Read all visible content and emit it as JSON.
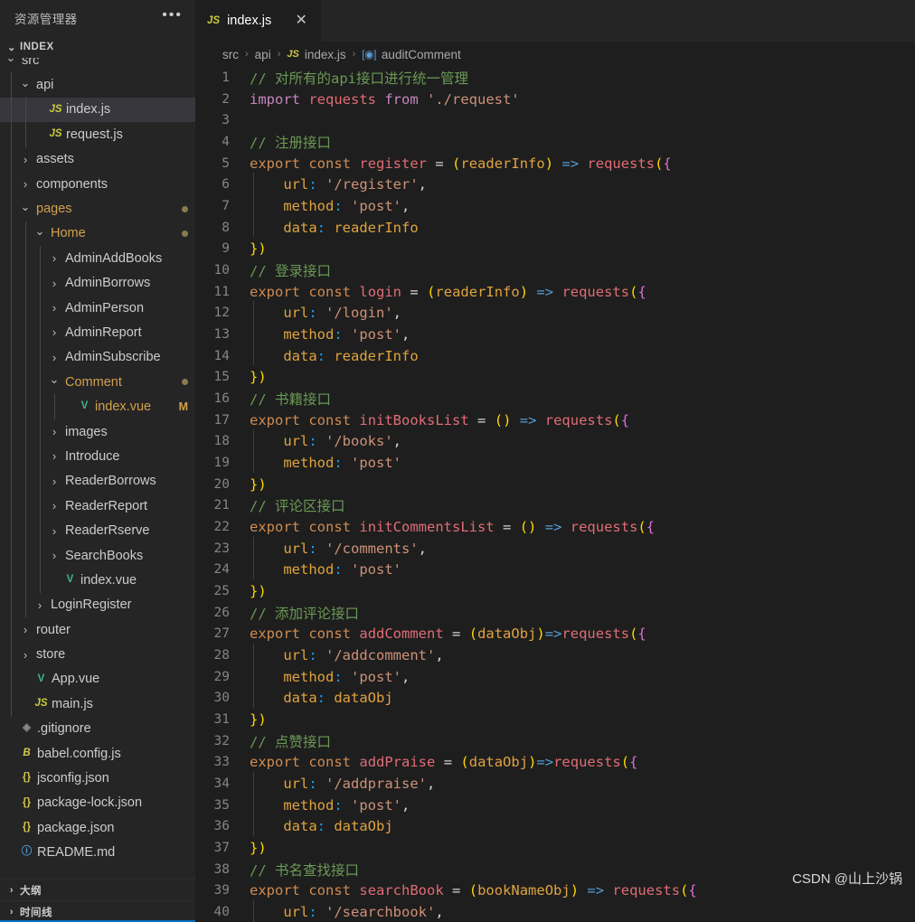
{
  "sidebar": {
    "title": "资源管理器",
    "more_label": "•••",
    "index_section": {
      "label": "INDEX",
      "chevron": "⌄"
    },
    "outline_section": {
      "label": "大纲",
      "chevron": "›"
    },
    "timeline_section": {
      "label": "时间线",
      "chevron": "›"
    },
    "tree": [
      {
        "label": "src",
        "kind": "folder",
        "indent": 0,
        "expanded": true,
        "clipped": true,
        "icon": "chevron-down-icon"
      },
      {
        "label": "api",
        "kind": "folder",
        "indent": 1,
        "expanded": true,
        "icon": "chevron-down-icon"
      },
      {
        "label": "index.js",
        "kind": "file",
        "indent": 2,
        "icon": "js-file-icon",
        "selected": true
      },
      {
        "label": "request.js",
        "kind": "file",
        "indent": 2,
        "icon": "js-file-icon"
      },
      {
        "label": "assets",
        "kind": "folder",
        "indent": 1,
        "expanded": false,
        "icon": "chevron-right-icon"
      },
      {
        "label": "components",
        "kind": "folder",
        "indent": 1,
        "expanded": false,
        "icon": "chevron-right-icon"
      },
      {
        "label": "pages",
        "kind": "folder",
        "indent": 1,
        "expanded": true,
        "icon": "chevron-down-icon",
        "dot": true
      },
      {
        "label": "Home",
        "kind": "folder",
        "indent": 2,
        "expanded": true,
        "icon": "chevron-down-icon",
        "dot": true
      },
      {
        "label": "AdminAddBooks",
        "kind": "folder",
        "indent": 3,
        "expanded": false,
        "icon": "chevron-right-icon"
      },
      {
        "label": "AdminBorrows",
        "kind": "folder",
        "indent": 3,
        "expanded": false,
        "icon": "chevron-right-icon"
      },
      {
        "label": "AdminPerson",
        "kind": "folder",
        "indent": 3,
        "expanded": false,
        "icon": "chevron-right-icon"
      },
      {
        "label": "AdminReport",
        "kind": "folder",
        "indent": 3,
        "expanded": false,
        "icon": "chevron-right-icon"
      },
      {
        "label": "AdminSubscribe",
        "kind": "folder",
        "indent": 3,
        "expanded": false,
        "icon": "chevron-right-icon"
      },
      {
        "label": "Comment",
        "kind": "folder",
        "indent": 3,
        "expanded": true,
        "icon": "chevron-down-icon",
        "dot": true
      },
      {
        "label": "index.vue",
        "kind": "file",
        "indent": 4,
        "icon": "vue-file-icon",
        "badge": "M"
      },
      {
        "label": "images",
        "kind": "folder",
        "indent": 3,
        "expanded": false,
        "icon": "chevron-right-icon"
      },
      {
        "label": "Introduce",
        "kind": "folder",
        "indent": 3,
        "expanded": false,
        "icon": "chevron-right-icon"
      },
      {
        "label": "ReaderBorrows",
        "kind": "folder",
        "indent": 3,
        "expanded": false,
        "icon": "chevron-right-icon"
      },
      {
        "label": "ReaderReport",
        "kind": "folder",
        "indent": 3,
        "expanded": false,
        "icon": "chevron-right-icon"
      },
      {
        "label": "ReaderRserve",
        "kind": "folder",
        "indent": 3,
        "expanded": false,
        "icon": "chevron-right-icon"
      },
      {
        "label": "SearchBooks",
        "kind": "folder",
        "indent": 3,
        "expanded": false,
        "icon": "chevron-right-icon"
      },
      {
        "label": "index.vue",
        "kind": "file",
        "indent": 3,
        "icon": "vue-file-icon"
      },
      {
        "label": "LoginRegister",
        "kind": "folder",
        "indent": 2,
        "expanded": false,
        "icon": "chevron-right-icon"
      },
      {
        "label": "router",
        "kind": "folder",
        "indent": 1,
        "expanded": false,
        "icon": "chevron-right-icon"
      },
      {
        "label": "store",
        "kind": "folder",
        "indent": 1,
        "expanded": false,
        "icon": "chevron-right-icon"
      },
      {
        "label": "App.vue",
        "kind": "file",
        "indent": 1,
        "icon": "vue-file-icon"
      },
      {
        "label": "main.js",
        "kind": "file",
        "indent": 1,
        "icon": "js-file-icon"
      },
      {
        "label": ".gitignore",
        "kind": "file",
        "indent": 0,
        "icon": "git-file-icon"
      },
      {
        "label": "babel.config.js",
        "kind": "file",
        "indent": 0,
        "icon": "babel-file-icon"
      },
      {
        "label": "jsconfig.json",
        "kind": "file",
        "indent": 0,
        "icon": "json-file-icon"
      },
      {
        "label": "package-lock.json",
        "kind": "file",
        "indent": 0,
        "icon": "json-file-icon"
      },
      {
        "label": "package.json",
        "kind": "file",
        "indent": 0,
        "icon": "json-file-icon"
      },
      {
        "label": "README.md",
        "kind": "file",
        "indent": 0,
        "icon": "markdown-file-icon"
      }
    ]
  },
  "editor": {
    "tab": {
      "label": "index.js",
      "icon": "js-file-icon",
      "close": "✕"
    },
    "breadcrumb": [
      {
        "label": "src",
        "icon": null
      },
      {
        "label": "api",
        "icon": null
      },
      {
        "label": "index.js",
        "icon": "js-file-icon"
      },
      {
        "label": "auditComment",
        "icon": "symbol-method-icon"
      }
    ],
    "breadcrumb_separator": "›",
    "first_line": 1,
    "last_line": 40,
    "lines": [
      {
        "n": 1,
        "text": "// 对所有的api接口进行统一管理"
      },
      {
        "n": 2,
        "text": "import requests from './request'"
      },
      {
        "n": 3,
        "text": ""
      },
      {
        "n": 4,
        "text": "// 注册接口"
      },
      {
        "n": 5,
        "text": "export const register = (readerInfo) => requests({"
      },
      {
        "n": 6,
        "text": "    url: '/register',"
      },
      {
        "n": 7,
        "text": "    method: 'post',"
      },
      {
        "n": 8,
        "text": "    data: readerInfo"
      },
      {
        "n": 9,
        "text": "})"
      },
      {
        "n": 10,
        "text": "// 登录接口"
      },
      {
        "n": 11,
        "text": "export const login = (readerInfo) => requests({"
      },
      {
        "n": 12,
        "text": "    url: '/login',"
      },
      {
        "n": 13,
        "text": "    method: 'post',"
      },
      {
        "n": 14,
        "text": "    data: readerInfo"
      },
      {
        "n": 15,
        "text": "})"
      },
      {
        "n": 16,
        "text": "// 书籍接口"
      },
      {
        "n": 17,
        "text": "export const initBooksList = () => requests({"
      },
      {
        "n": 18,
        "text": "    url: '/books',"
      },
      {
        "n": 19,
        "text": "    method: 'post'"
      },
      {
        "n": 20,
        "text": "})"
      },
      {
        "n": 21,
        "text": "// 评论区接口"
      },
      {
        "n": 22,
        "text": "export const initCommentsList = () => requests({"
      },
      {
        "n": 23,
        "text": "    url: '/comments',"
      },
      {
        "n": 24,
        "text": "    method: 'post'"
      },
      {
        "n": 25,
        "text": "})"
      },
      {
        "n": 26,
        "text": "// 添加评论接口"
      },
      {
        "n": 27,
        "text": "export const addComment = (dataObj)=>requests({"
      },
      {
        "n": 28,
        "text": "    url: '/addcomment',"
      },
      {
        "n": 29,
        "text": "    method: 'post',"
      },
      {
        "n": 30,
        "text": "    data: dataObj"
      },
      {
        "n": 31,
        "text": "})"
      },
      {
        "n": 32,
        "text": "// 点赞接口"
      },
      {
        "n": 33,
        "text": "export const addPraise = (dataObj)=>requests({"
      },
      {
        "n": 34,
        "text": "    url: '/addpraise',"
      },
      {
        "n": 35,
        "text": "    method: 'post',"
      },
      {
        "n": 36,
        "text": "    data: dataObj"
      },
      {
        "n": 37,
        "text": "})"
      },
      {
        "n": 38,
        "text": "// 书名查找接口"
      },
      {
        "n": 39,
        "text": "export const searchBook = (bookNameObj) => requests({"
      },
      {
        "n": 40,
        "text": "    url: '/searchbook',"
      }
    ]
  },
  "watermark": {
    "text": "CSDN @山上沙锅"
  },
  "colors": {
    "sidebar_bg": "#252526",
    "editor_bg": "#1e1e1e",
    "selected_row": "#37373d",
    "accent": "#0a6ebd",
    "comment": "#6a9955",
    "keyword": "#c586c0",
    "string": "#ce9178",
    "function": "#dcdcaa",
    "modified_badge": "#d2a04a"
  }
}
